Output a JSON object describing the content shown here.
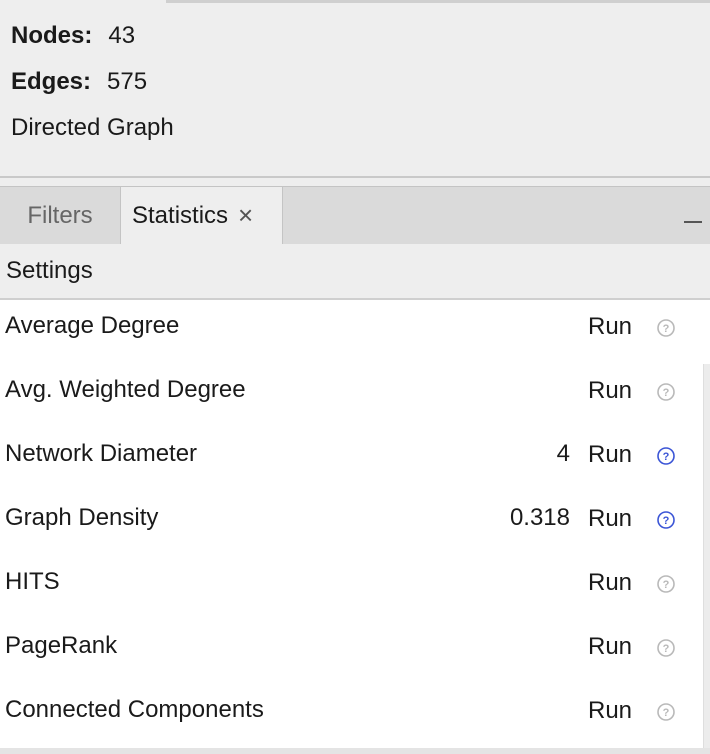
{
  "graph_info": {
    "nodes_label": "Nodes:",
    "nodes_value": "43",
    "edges_label": "Edges:",
    "edges_value": "575",
    "graph_type": "Directed Graph"
  },
  "tabs": [
    {
      "label": "Filters",
      "active": false
    },
    {
      "label": "Statistics",
      "active": true,
      "close_glyph": "×"
    }
  ],
  "settings_label": "Settings",
  "statistics": [
    {
      "name": "Average Degree",
      "value": "",
      "run_label": "Run",
      "help_icon": "help-icon-disabled"
    },
    {
      "name": "Avg. Weighted Degree",
      "value": "",
      "run_label": "Run",
      "help_icon": "help-icon-disabled"
    },
    {
      "name": "Network Diameter",
      "value": "4",
      "run_label": "Run",
      "help_icon": "help-icon-active"
    },
    {
      "name": "Graph Density",
      "value": "0.318",
      "run_label": "Run",
      "help_icon": "help-icon-active"
    },
    {
      "name": "HITS",
      "value": "",
      "run_label": "Run",
      "help_icon": "help-icon-disabled"
    },
    {
      "name": "PageRank",
      "value": "",
      "run_label": "Run",
      "help_icon": "help-icon-disabled"
    },
    {
      "name": "Connected Components",
      "value": "",
      "run_label": "Run",
      "help_icon": "help-icon-disabled"
    }
  ],
  "colors": {
    "help_active": "#3b55d6",
    "help_disabled": "#b9b9b9"
  }
}
